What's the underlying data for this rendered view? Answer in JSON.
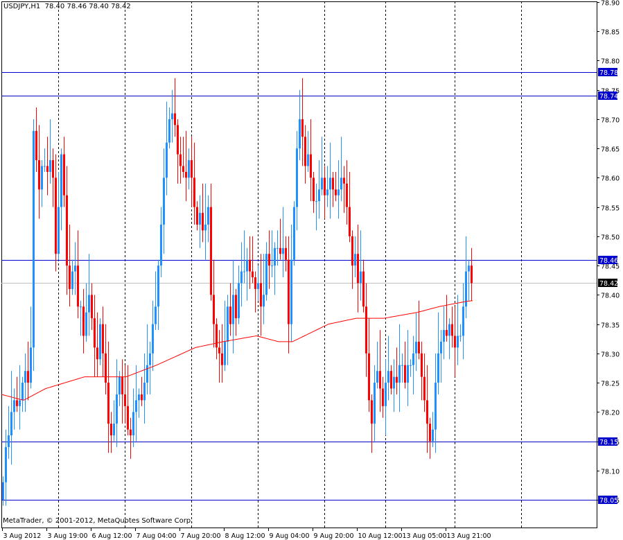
{
  "header": {
    "symbol": "USDJPY,H1",
    "ohlc": "78.40 78.46 78.40 78.42"
  },
  "copyright": "MetaTrader, © 2001-2012, MetaQuotes Software Corp.",
  "colors": {
    "bull": "#1E90FF",
    "bear": "#FF0000",
    "ma": "#FF0000",
    "level": "#0000CC",
    "bid": "#C0C0C0",
    "grid": "#000000"
  },
  "chart_data": {
    "type": "candlestick",
    "title": "USDJPY,H1",
    "ylim": [
      78.0,
      78.9
    ],
    "y_ticks": [
      "78.90",
      "78.85",
      "78.80",
      "78.75",
      "78.70",
      "78.65",
      "78.60",
      "78.55",
      "78.50",
      "78.45",
      "78.40",
      "78.35",
      "78.30",
      "78.25",
      "78.20",
      "78.15",
      "78.10",
      "78.05"
    ],
    "x_labels": [
      {
        "bar": 0,
        "label": "3 Aug 2012"
      },
      {
        "bar": 16,
        "label": "3 Aug 19:00"
      },
      {
        "bar": 32,
        "label": "6 Aug 12:00"
      },
      {
        "bar": 48,
        "label": "7 Aug 04:00"
      },
      {
        "bar": 64,
        "label": "7 Aug 20:00"
      },
      {
        "bar": 80,
        "label": "8 Aug 12:00"
      },
      {
        "bar": 96,
        "label": "9 Aug 04:00"
      },
      {
        "bar": 112,
        "label": "9 Aug 20:00"
      },
      {
        "bar": 128,
        "label": "10 Aug 12:00"
      },
      {
        "bar": 144,
        "label": "13 Aug 05:00"
      },
      {
        "bar": 160,
        "label": "13 Aug 21:00"
      }
    ],
    "grid_bars": [
      20,
      44,
      68,
      92,
      116,
      138,
      163,
      187
    ],
    "close": [
      78.08,
      78.14,
      78.16,
      78.2,
      78.22,
      78.21,
      78.22,
      78.25,
      78.27,
      78.25,
      78.31,
      78.68,
      78.63,
      78.58,
      78.62,
      78.62,
      78.61,
      78.63,
      78.6,
      78.47,
      78.55,
      78.64,
      78.57,
      78.45,
      78.41,
      78.44,
      78.45,
      78.38,
      78.38,
      78.33,
      78.37,
      78.4,
      78.36,
      78.31,
      78.29,
      78.35,
      78.3,
      78.25,
      78.18,
      78.16,
      78.18,
      78.23,
      78.26,
      78.23,
      78.21,
      78.17,
      78.16,
      78.2,
      78.22,
      78.23,
      78.22,
      78.25,
      78.28,
      78.3,
      78.35,
      78.38,
      78.45,
      78.52,
      78.6,
      78.66,
      78.7,
      78.71,
      78.69,
      78.64,
      78.62,
      78.61,
      78.6,
      78.63,
      78.6,
      78.55,
      78.52,
      78.54,
      78.51,
      78.52,
      78.55,
      78.4,
      78.35,
      78.31,
      78.3,
      78.28,
      78.32,
      78.38,
      78.35,
      78.4,
      78.36,
      78.42,
      78.44,
      78.44,
      78.46,
      78.44,
      78.43,
      78.41,
      78.42,
      78.38,
      78.4,
      78.47,
      78.45,
      78.45,
      78.48,
      78.48,
      78.47,
      78.48,
      78.46,
      78.35,
      78.46,
      78.55,
      78.65,
      78.7,
      78.67,
      78.62,
      78.64,
      78.6,
      78.56,
      78.56,
      78.58,
      78.6,
      78.57,
      78.58,
      78.6,
      78.58,
      78.57,
      78.58,
      78.6,
      78.59,
      78.55,
      78.5,
      78.45,
      78.47,
      78.42,
      78.44,
      78.38,
      78.3,
      78.22,
      78.18,
      78.25,
      78.27,
      78.24,
      78.21,
      78.25,
      78.27,
      78.24,
      78.26,
      78.25,
      78.28,
      78.28,
      78.25,
      78.28,
      78.28,
      78.3,
      78.32,
      78.3,
      78.26,
      78.22,
      78.18,
      78.15,
      78.17,
      78.25,
      78.3,
      78.32,
      78.34,
      78.33,
      78.35,
      78.33,
      78.31,
      78.33,
      78.33,
      78.38,
      78.44,
      78.45,
      78.42
    ],
    "ma": [
      [
        0,
        78.23
      ],
      [
        8,
        78.22
      ],
      [
        16,
        78.24
      ],
      [
        30,
        78.26
      ],
      [
        45,
        78.26
      ],
      [
        56,
        78.28
      ],
      [
        70,
        78.31
      ],
      [
        80,
        78.32
      ],
      [
        92,
        78.33
      ],
      [
        100,
        78.32
      ],
      [
        105,
        78.32
      ],
      [
        118,
        78.35
      ],
      [
        128,
        78.36
      ],
      [
        138,
        78.36
      ],
      [
        150,
        78.37
      ],
      [
        158,
        78.38
      ],
      [
        169,
        78.39
      ]
    ],
    "levels": [
      {
        "price": 78.78,
        "label": "78.78"
      },
      {
        "price": 78.74,
        "label": "78.74"
      },
      {
        "price": 78.46,
        "label": "78.46"
      },
      {
        "price": 78.15,
        "label": "78.15"
      },
      {
        "price": 78.05,
        "label": "78.05"
      }
    ],
    "bid": {
      "price": 78.42,
      "label": "78.42"
    }
  }
}
